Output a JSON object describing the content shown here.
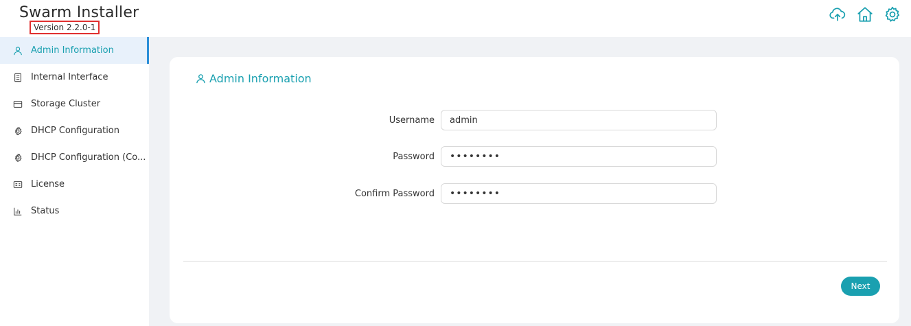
{
  "app": {
    "title": "Swarm Installer",
    "version": "Version 2.2.0-1"
  },
  "header_icons": [
    "cloud-upload-icon",
    "home-icon",
    "gear-icon"
  ],
  "colors": {
    "accent": "#1aa0b0",
    "active_bar": "#2a8ed8",
    "active_bg": "#e8f1fb",
    "main_bg": "#f0f2f5",
    "highlight_box": "#e03030"
  },
  "sidebar": {
    "items": [
      {
        "label": "Admin Information",
        "icon": "user-icon",
        "active": true
      },
      {
        "label": "Internal Interface",
        "icon": "server-icon",
        "active": false
      },
      {
        "label": "Storage Cluster",
        "icon": "storage-icon",
        "active": false
      },
      {
        "label": "DHCP Configuration",
        "icon": "gear-icon",
        "active": false
      },
      {
        "label": "DHCP Configuration (Co...",
        "icon": "gear-icon",
        "active": false
      },
      {
        "label": "License",
        "icon": "license-icon",
        "active": false
      },
      {
        "label": "Status",
        "icon": "chart-icon",
        "active": false
      }
    ]
  },
  "card": {
    "title": "Admin Information",
    "fields": [
      {
        "label": "Username",
        "value": "admin",
        "type": "text"
      },
      {
        "label": "Password",
        "value": "••••••••",
        "type": "password"
      },
      {
        "label": "Confirm Password",
        "value": "••••••••",
        "type": "password"
      }
    ],
    "next_label": "Next"
  }
}
